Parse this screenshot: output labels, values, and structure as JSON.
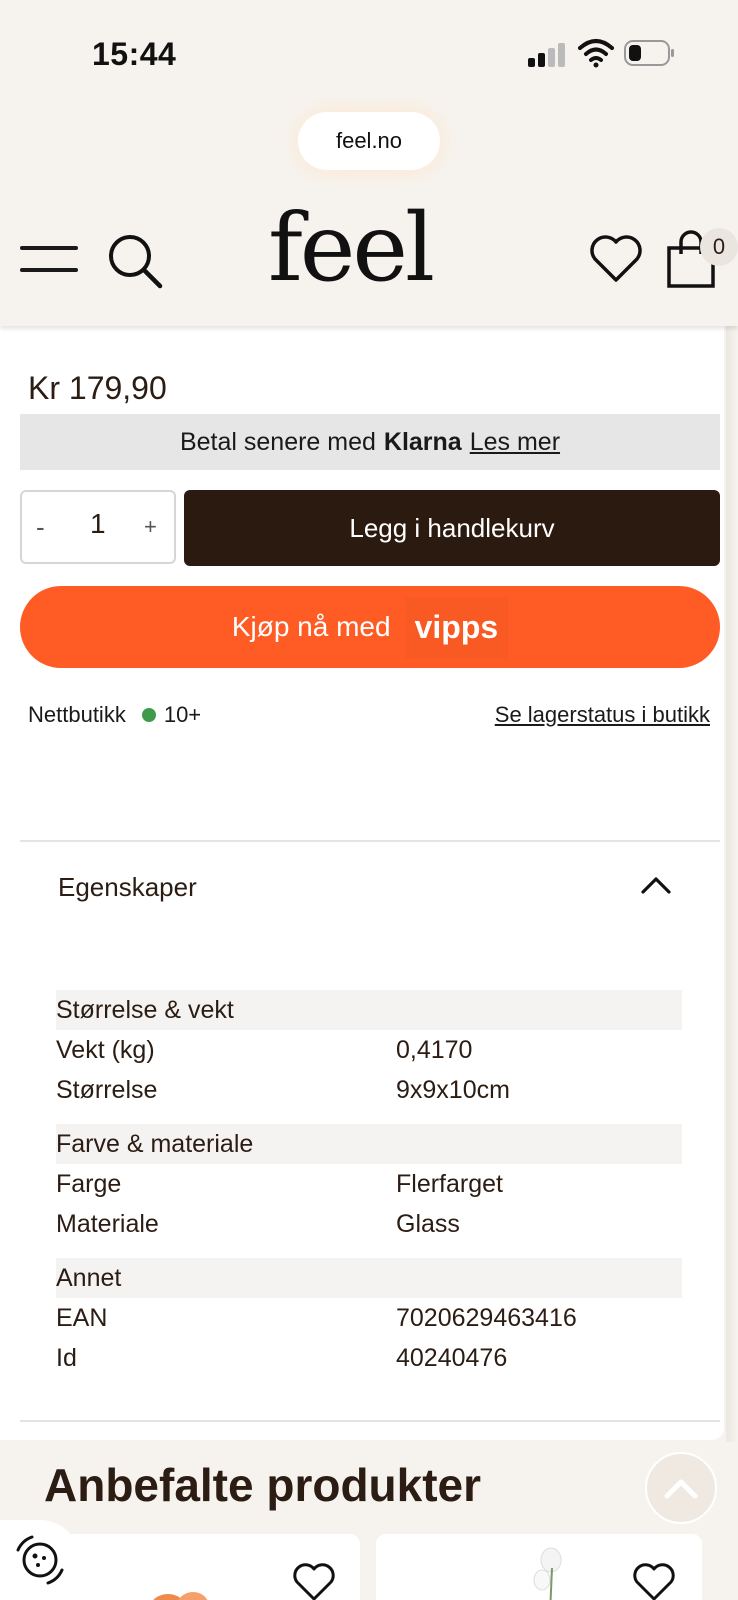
{
  "status_bar": {
    "time": "15:44"
  },
  "browser": {
    "url": "feel.no"
  },
  "header": {
    "logo": "feel",
    "cart_count": "0"
  },
  "product": {
    "price": "Kr 179,90",
    "klarna": {
      "text": "Betal senere med",
      "brand": "Klarna",
      "link": "Les mer"
    },
    "quantity": {
      "minus": "-",
      "value": "1",
      "plus": "+"
    },
    "add_to_cart": "Legg i handlekurv",
    "vipps": {
      "label": "Kjøp nå med",
      "brand": "vipps"
    },
    "stock": {
      "label": "Nettbutikk",
      "count": "10+",
      "store_link": "Se lagerstatus i butikk"
    }
  },
  "properties": {
    "title": "Egenskaper",
    "groups": [
      {
        "title": "Størrelse & vekt",
        "rows": [
          {
            "key": "Vekt (kg)",
            "value": "0,4170"
          },
          {
            "key": "Størrelse",
            "value": "9x9x10cm"
          }
        ]
      },
      {
        "title": "Farve & materiale",
        "rows": [
          {
            "key": "Farge",
            "value": "Flerfarget"
          },
          {
            "key": "Materiale",
            "value": "Glass"
          }
        ]
      },
      {
        "title": "Annet",
        "rows": [
          {
            "key": "EAN",
            "value": "7020629463416"
          },
          {
            "key": "Id",
            "value": "40240476"
          }
        ]
      }
    ]
  },
  "recommendations": {
    "title": "Anbefalte produkter"
  },
  "colors": {
    "brand_dark": "#2b1a10",
    "vipps_orange": "#ff5b24",
    "stock_green": "#3d9b4a"
  }
}
